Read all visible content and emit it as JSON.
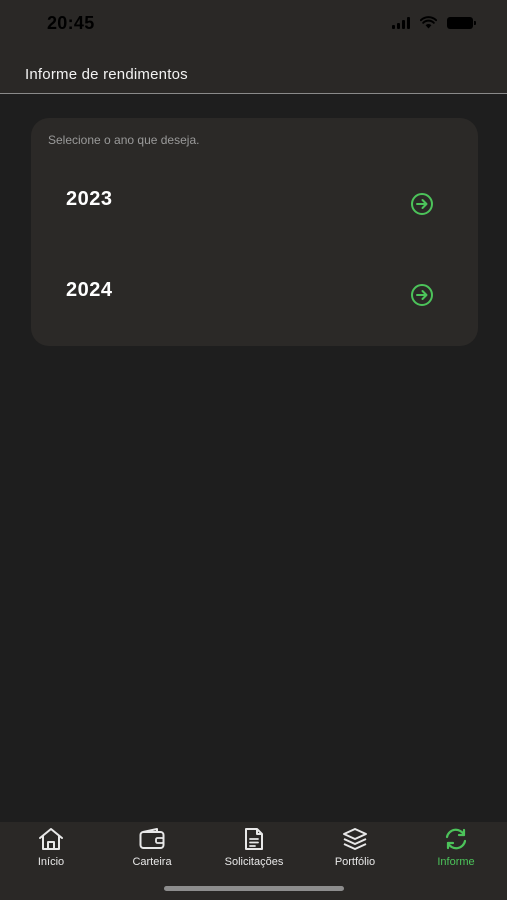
{
  "status_bar": {
    "time": "20:45",
    "icons": [
      "signal-icon",
      "wifi-icon",
      "battery-icon"
    ]
  },
  "header": {
    "title": "Informe de rendimentos"
  },
  "card": {
    "hint": "Selecione o ano que deseja.",
    "years": [
      {
        "label": "2023",
        "icon": "arrow-right-circle-icon"
      },
      {
        "label": "2024",
        "icon": "arrow-right-circle-icon"
      }
    ]
  },
  "tab_bar": {
    "tabs": [
      {
        "label": "Início",
        "icon": "home-icon",
        "active": false
      },
      {
        "label": "Carteira",
        "icon": "wallet-icon",
        "active": false
      },
      {
        "label": "Solicitações",
        "icon": "document-icon",
        "active": false
      },
      {
        "label": "Portfólio",
        "icon": "layers-icon",
        "active": false
      },
      {
        "label": "Informe",
        "icon": "refresh-icon",
        "active": true
      }
    ]
  },
  "colors": {
    "background": "#1e1e1e",
    "surface": "#2b2927",
    "accent": "#4cc35a",
    "text": "#ffffff",
    "muted": "#9a9a9a"
  }
}
